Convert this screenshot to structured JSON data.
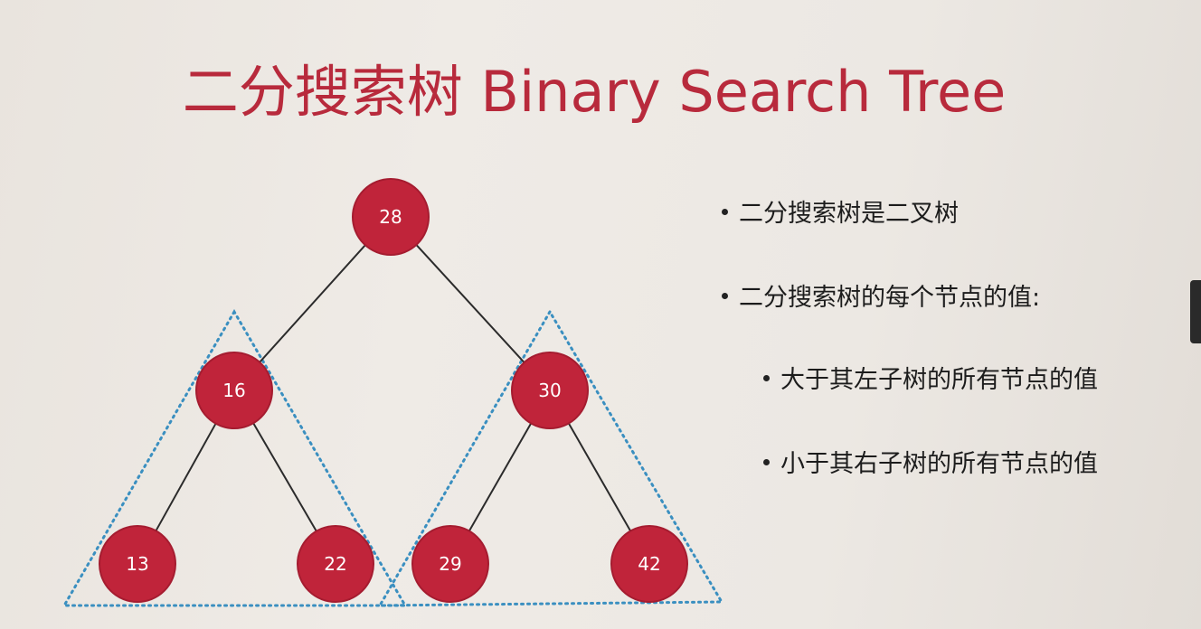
{
  "title": "二分搜索树 Binary Search Tree",
  "tree": {
    "nodes": [
      {
        "id": "n28",
        "label": "28"
      },
      {
        "id": "n16",
        "label": "16"
      },
      {
        "id": "n30",
        "label": "30"
      },
      {
        "id": "n13",
        "label": "13"
      },
      {
        "id": "n22",
        "label": "22"
      },
      {
        "id": "n29",
        "label": "29"
      },
      {
        "id": "n42",
        "label": "42"
      }
    ],
    "edges": [
      [
        "n28",
        "n16"
      ],
      [
        "n28",
        "n30"
      ],
      [
        "n16",
        "n13"
      ],
      [
        "n16",
        "n22"
      ],
      [
        "n30",
        "n29"
      ],
      [
        "n30",
        "n42"
      ]
    ],
    "colors": {
      "node": "#c0243a",
      "node_border": "#a51c30",
      "edge": "#2b2b2b",
      "subtree_outline": "#3a8fc0"
    }
  },
  "bullets": [
    {
      "text": "二分搜索树是二叉树"
    },
    {
      "text": "二分搜索树的每个节点的值:"
    },
    {
      "text": "大于其左子树的所有节点的值"
    },
    {
      "text": "小于其右子树的所有节点的值"
    }
  ]
}
